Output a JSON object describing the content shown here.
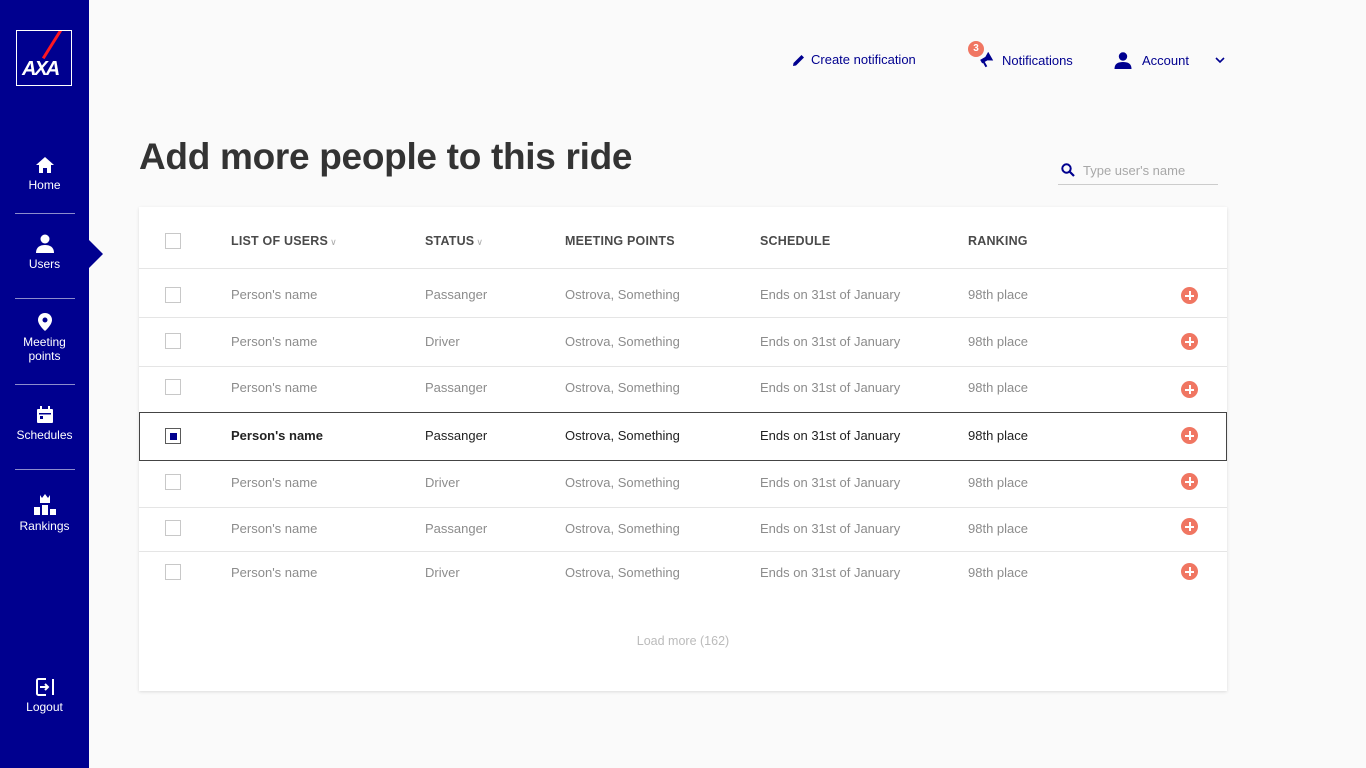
{
  "brand": {
    "logo_text": "AXA",
    "sidebar_color": "#00008f",
    "accent_color": "#f07662"
  },
  "sidebar": {
    "items": [
      {
        "label": "Home",
        "icon": "home-icon"
      },
      {
        "label": "Users",
        "icon": "user-icon",
        "active": true
      },
      {
        "label": "Meeting points",
        "icon": "location-pin-icon"
      },
      {
        "label": "Schedules",
        "icon": "calendar-icon"
      },
      {
        "label": "Rankings",
        "icon": "rankings-icon"
      }
    ],
    "logout": {
      "label": "Logout",
      "icon": "logout-icon"
    }
  },
  "header": {
    "create_notification": "Create notification",
    "notifications": "Notifications",
    "notifications_count": "3",
    "account": "Account"
  },
  "page": {
    "title": "Add more people to this ride",
    "search_placeholder": "Type user's name"
  },
  "table": {
    "columns": [
      "LIST OF USERS",
      "STATUS",
      "MEETING POINTS",
      "SCHEDULE",
      "RANKING"
    ],
    "rows": [
      {
        "name": "Person's name",
        "status": "Passanger",
        "meeting_point": "Ostrova, Something",
        "schedule": "Ends on 31st of January",
        "ranking": "98th place",
        "checked": false
      },
      {
        "name": "Person's name",
        "status": "Driver",
        "meeting_point": "Ostrova, Something",
        "schedule": "Ends on 31st of January",
        "ranking": "98th place",
        "checked": false
      },
      {
        "name": "Person's name",
        "status": "Passanger",
        "meeting_point": "Ostrova, Something",
        "schedule": "Ends on 31st of January",
        "ranking": "98th place",
        "checked": false
      },
      {
        "name": "Person's name",
        "status": "Passanger",
        "meeting_point": "Ostrova, Something",
        "schedule": "Ends on 31st of January",
        "ranking": "98th place",
        "checked": true
      },
      {
        "name": "Person's name",
        "status": "Driver",
        "meeting_point": "Ostrova, Something",
        "schedule": "Ends on 31st of January",
        "ranking": "98th place",
        "checked": false
      },
      {
        "name": "Person's name",
        "status": "Passanger",
        "meeting_point": "Ostrova, Something",
        "schedule": "Ends on 31st of January",
        "ranking": "98th place",
        "checked": false
      },
      {
        "name": "Person's name",
        "status": "Driver",
        "meeting_point": "Ostrova, Something",
        "schedule": "Ends on 31st of January",
        "ranking": "98th place",
        "checked": false
      }
    ],
    "load_more": "Load more (162)"
  }
}
